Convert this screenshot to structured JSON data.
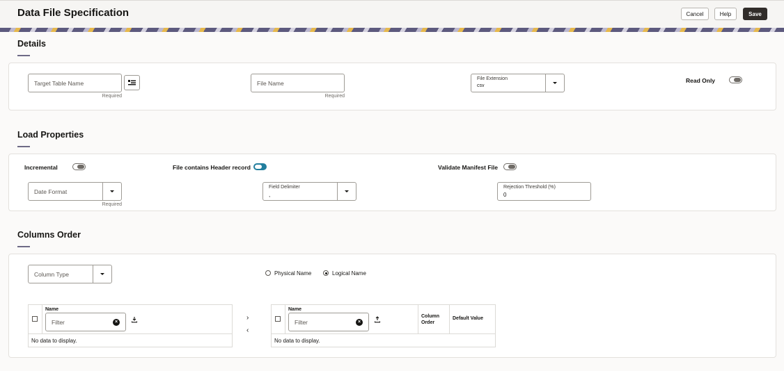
{
  "header": {
    "title": "Data File Specification",
    "cancel_label": "Cancel",
    "help_label": "Help",
    "save_label": "Save"
  },
  "details": {
    "title": "Details",
    "target_table": {
      "placeholder": "Target Table Name",
      "helper": "Required"
    },
    "file_name": {
      "placeholder": "File Name",
      "helper": "Required"
    },
    "file_extension": {
      "label": "File Extension",
      "value": "csv"
    },
    "read_only": {
      "label": "Read Only",
      "on": false
    }
  },
  "load_properties": {
    "title": "Load Properties",
    "incremental": {
      "label": "Incremental",
      "on": false
    },
    "header_record": {
      "label": "File contains Header record",
      "on": true
    },
    "validate_manifest": {
      "label": "Validate Manifest File",
      "on": false
    },
    "date_format": {
      "placeholder": "Date Format",
      "helper": "Required"
    },
    "field_delimiter": {
      "label": "Field Delimiter",
      "value": ","
    },
    "rejection_threshold": {
      "label": "Rejection Threshold (%)",
      "value": "0"
    }
  },
  "columns_order": {
    "title": "Columns Order",
    "column_type": {
      "placeholder": "Column Type"
    },
    "radio_options": [
      {
        "label": "Physical Name",
        "selected": false
      },
      {
        "label": "Logical Name",
        "selected": true
      }
    ],
    "left_table": {
      "header_name": "Name",
      "filter_placeholder": "Filter",
      "empty_text": "No data to display."
    },
    "right_table": {
      "header_name": "Name",
      "filter_placeholder": "Filter",
      "column_order_header": "Column Order",
      "default_value_header": "Default Value",
      "empty_text": "No data to display."
    },
    "move_right_glyph": "›",
    "move_left_glyph": "‹"
  },
  "icons": {
    "columns_picker": "list-icon",
    "dropdown": "chevron-down-icon",
    "clear": "clear-icon",
    "download": "download-icon",
    "upload": "upload-icon"
  },
  "colors": {
    "accent": "#227e9e",
    "primary_button": "#312d2a",
    "underline": "#6e6a86"
  }
}
